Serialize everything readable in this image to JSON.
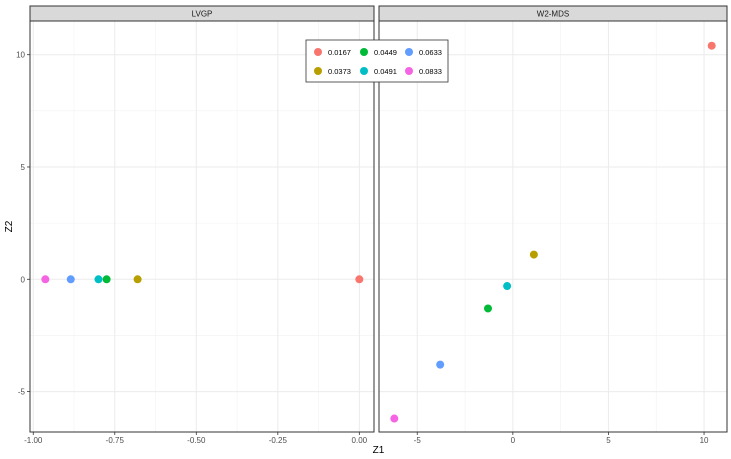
{
  "chart_data": {
    "type": "scatter",
    "xlabel": "Z1",
    "ylabel": "Z2",
    "ylim": [
      -6.8,
      11.5
    ],
    "yticks": [
      -5,
      0,
      5,
      10
    ],
    "grid": true,
    "legend_position": "top-center",
    "series_colors": {
      "0.0167": "#F8766D",
      "0.0373": "#B79F00",
      "0.0449": "#00BA38",
      "0.0491": "#00BFC4",
      "0.0633": "#619CFF",
      "0.0833": "#F564E3"
    },
    "legend_order": [
      "0.0167",
      "0.0449",
      "0.0633",
      "0.0373",
      "0.0491",
      "0.0833"
    ],
    "panels": [
      {
        "title": "LVGP",
        "xlim": [
          -1.01,
          0.045
        ],
        "xticks": [
          "-1.00",
          "-0.75",
          "-0.50",
          "-0.25",
          "0.00"
        ],
        "xtick_values": [
          -1.0,
          -0.75,
          -0.5,
          -0.25,
          0.0
        ],
        "points": [
          {
            "series": "0.0167",
            "x": 0.0,
            "y": 0.0
          },
          {
            "series": "0.0373",
            "x": -0.68,
            "y": 0.0
          },
          {
            "series": "0.0449",
            "x": -0.775,
            "y": 0.0
          },
          {
            "series": "0.0491",
            "x": -0.8,
            "y": 0.0
          },
          {
            "series": "0.0633",
            "x": -0.885,
            "y": 0.0
          },
          {
            "series": "0.0833",
            "x": -0.963,
            "y": 0.0
          }
        ]
      },
      {
        "title": "W2-MDS",
        "xlim": [
          -7.0,
          11.2
        ],
        "xticks": [
          "-5",
          "0",
          "5",
          "10"
        ],
        "xtick_values": [
          -5,
          0,
          5,
          10
        ],
        "points": [
          {
            "series": "0.0167",
            "x": 10.4,
            "y": 10.4
          },
          {
            "series": "0.0373",
            "x": 1.1,
            "y": 1.1
          },
          {
            "series": "0.0449",
            "x": -1.3,
            "y": -1.3
          },
          {
            "series": "0.0491",
            "x": -0.3,
            "y": -0.3
          },
          {
            "series": "0.0633",
            "x": -3.8,
            "y": -3.8
          },
          {
            "series": "0.0833",
            "x": -6.2,
            "y": -6.2
          }
        ]
      }
    ]
  }
}
